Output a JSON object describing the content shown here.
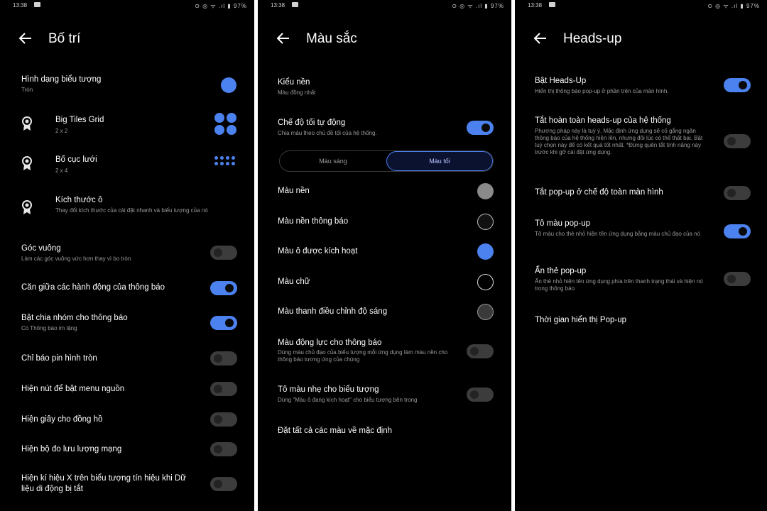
{
  "status": {
    "time": "13:38",
    "icons": "⊙ ◎ ᯤ .ıl ▮ 97%"
  },
  "colors": {
    "accent": "#4c82f0",
    "background": "#000000",
    "toggle_off": "#3c3c3c"
  },
  "layout_panel": {
    "title": "Bố trí",
    "back_icon": "arrow-left-icon",
    "icon_shape": {
      "label": "Hình dạng biểu tượng",
      "sub": "Tròn"
    },
    "big_tiles": {
      "label": "Big Tiles Grid",
      "sub": "2 x 2"
    },
    "grid_layout": {
      "label": "Bố cục lưới",
      "sub": "2 x 4"
    },
    "tile_size": {
      "label": "Kích thước ô",
      "sub": "Thay đổi kích thước của cài đặt nhanh và biểu tượng của nó"
    },
    "square_corners": {
      "label": "Góc vuông",
      "sub": "Làm các góc vuông vức hơn thay vì bo tròn",
      "on": false
    },
    "center_actions": {
      "label": "Căn giữa các hành động của thông báo",
      "on": true
    },
    "group_notifications": {
      "label": "Bật chia nhóm cho thông báo",
      "sub": "Có Thông báo im lặng",
      "on": true
    },
    "round_battery": {
      "label": "Chỉ báo pin hình tròn",
      "on": false
    },
    "power_menu_restart": {
      "label": "Hiện nút để bật menu nguồn",
      "on": false
    },
    "clock_seconds": {
      "label": "Hiện giây cho đồng hồ",
      "on": false
    },
    "traffic_meter": {
      "label": "Hiện bộ đo lưu lượng mạng",
      "on": false
    },
    "x_signal": {
      "label": "Hiện kí hiệu X trên biểu tượng tín hiệu khi Dữ",
      "label2": "liệu di động bị tắt",
      "on": false
    }
  },
  "color_panel": {
    "title": "Màu sắc",
    "back_icon": "arrow-left-icon",
    "bg_style": {
      "label": "Kiểu nền",
      "sub": "Màu đồng nhất"
    },
    "auto_dark": {
      "label": "Chế độ tối tự động",
      "sub": "Chia màu theo chủ đề tối của hệ thống.",
      "on": true
    },
    "segment": {
      "light": "Màu sáng",
      "dark": "Màu tối"
    },
    "bg_color": {
      "label": "Màu nền",
      "color": "#8a8a8a"
    },
    "notif_bg_color": {
      "label": "Màu nền thông báo",
      "color": "#2a2a2a"
    },
    "active_tile_color": {
      "label": "Màu ô được kích hoạt",
      "color": "#4c82f0"
    },
    "text_color": {
      "label": "Màu chữ",
      "color": "#000000"
    },
    "brightness_color": {
      "label": "Màu thanh điều chỉnh độ sáng",
      "color": "#3a3a3a"
    },
    "dynamic_notif_color": {
      "label": "Màu động lực cho thông báo",
      "sub": "Dùng màu chủ đạo của biểu tượng mỗi ứng dụng làm màu nền cho thông báo tương ứng của chúng",
      "on": false
    },
    "tint_icons": {
      "label": "Tô màu nhẹ cho biểu tượng",
      "sub": "Dùng \"Màu ô đang kích hoạt\" cho biểu tượng bên trong",
      "on": false
    },
    "reset_colors": {
      "label": "Đặt tất cả các màu về mặc định"
    }
  },
  "headsup_panel": {
    "title": "Heads-up",
    "back_icon": "arrow-left-icon",
    "enable": {
      "label": "Bật Heads-Up",
      "sub": "Hiển thị thông báo pop-up ở phần trên của màn hình.",
      "on": true
    },
    "disable_system": {
      "label": "Tắt hoàn toàn heads-up của hệ thống",
      "sub": "Phương pháp này là tuỳ ý. Mặc định ứng dụng sẽ cố gắng ngăn thông báo của hệ thống hiện lên, nhưng đôi lúc có thể thất bại. Bật tuỳ chọn này để có kết quả tốt nhất. *Đừng quên tắt tính năng này trước khi gỡ cài đặt ứng dụng.",
      "on": false
    },
    "fullscreen_off": {
      "label": "Tắt pop-up ở chế độ toàn màn hình",
      "on": false
    },
    "colorize": {
      "label": "Tô màu pop-up",
      "sub": "Tô màu cho thẻ nhỏ hiện tên ứng dụng bằng màu chủ đạo của nó",
      "on": true
    },
    "hide_card": {
      "label": "Ẩn thẻ pop-up",
      "sub": "Ẩn thẻ nhỏ hiện tên ứng dụng phía trên thanh trạng thái và hiện nó trong thông báo",
      "on": false
    },
    "display_time": {
      "label": "Thời gian hiển thị Pop-up"
    }
  }
}
